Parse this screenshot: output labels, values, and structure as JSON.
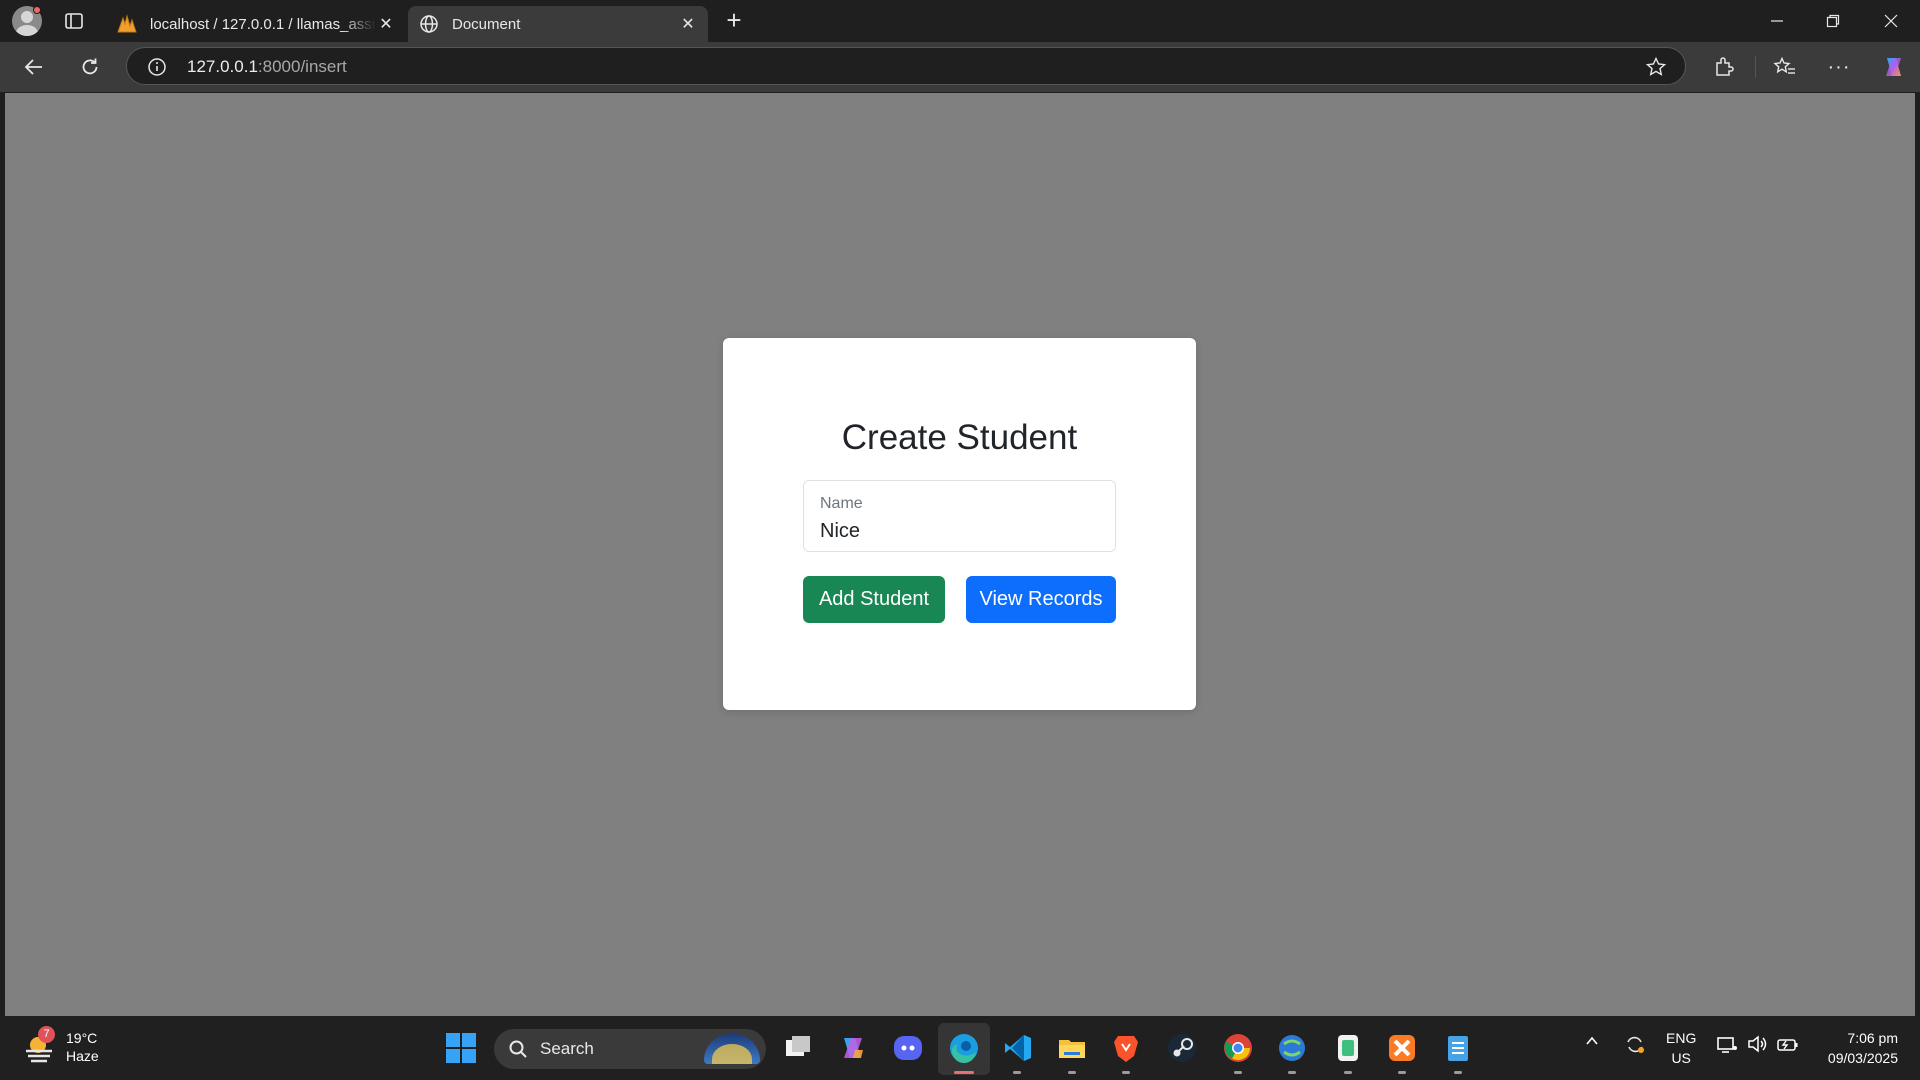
{
  "browser": {
    "tabs": [
      {
        "title": "localhost / 127.0.0.1 / llamas_assi",
        "active": false
      },
      {
        "title": "Document",
        "active": true
      }
    ],
    "address": {
      "host": "127.0.0.1",
      "rest": ":8000/insert"
    }
  },
  "page": {
    "heading": "Create Student",
    "name_field": {
      "label": "Name",
      "value": "Nice"
    },
    "add_button": "Add Student",
    "view_button": "View Records"
  },
  "colors": {
    "page_background": "#808080",
    "success": "#198754",
    "primary": "#0d6efd"
  },
  "taskbar": {
    "weather": {
      "temp": "19°C",
      "condition": "Haze",
      "badge": "7"
    },
    "search_label": "Search",
    "language": {
      "line1": "ENG",
      "line2": "US"
    },
    "clock": {
      "time": "7:06 pm",
      "date": "09/03/2025"
    },
    "apps": [
      "task-view",
      "copilot",
      "discord",
      "edge",
      "vscode",
      "file-explorer",
      "brave",
      "steam",
      "chrome",
      "python-idle",
      "notepad-app",
      "xampp",
      "notepad"
    ]
  }
}
